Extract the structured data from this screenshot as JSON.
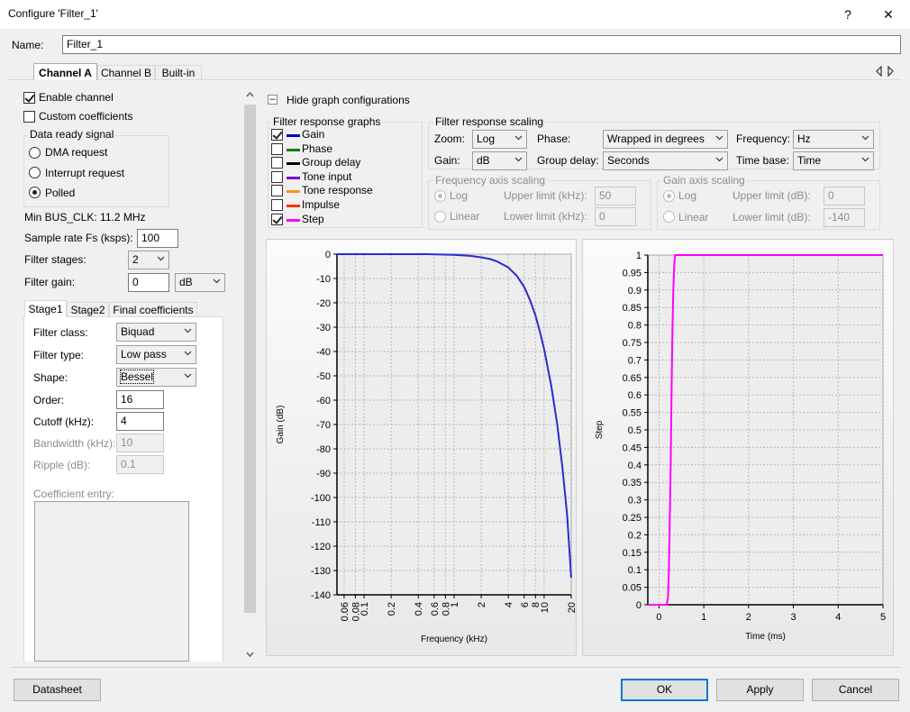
{
  "window": {
    "title": "Configure 'Filter_1'",
    "help_glyph": "?",
    "close_glyph": "✕"
  },
  "name_field": {
    "label": "Name:",
    "value": "Filter_1"
  },
  "tabs": {
    "channel_a": "Channel A",
    "channel_b": "Channel B",
    "builtin": "Built-in"
  },
  "left": {
    "enable_channel": "Enable channel",
    "custom_coefficients": "Custom coefficients",
    "data_ready": {
      "title": "Data ready signal",
      "dma": "DMA request",
      "interrupt": "Interrupt request",
      "polled": "Polled"
    },
    "min_bus_clk": "Min BUS_CLK: 11.2 MHz",
    "sample_rate": {
      "label": "Sample rate Fs (ksps):",
      "value": "100"
    },
    "filter_stages": {
      "label": "Filter stages:",
      "value": "2"
    },
    "filter_gain": {
      "label": "Filter gain:",
      "value": "0",
      "unit": "dB"
    },
    "stage_tabs": {
      "stage1": "Stage1",
      "stage2": "Stage2",
      "final": "Final coefficients"
    },
    "filter_class": {
      "label": "Filter class:",
      "value": "Biquad"
    },
    "filter_type": {
      "label": "Filter type:",
      "value": "Low pass"
    },
    "shape": {
      "label": "Shape:",
      "value": "Bessel"
    },
    "order": {
      "label": "Order:",
      "value": "16"
    },
    "cutoff": {
      "label": "Cutoff (kHz):",
      "value": "4"
    },
    "bandwidth": {
      "label": "Bandwidth (kHz):",
      "value": "10"
    },
    "ripple": {
      "label": "Ripple (dB):",
      "value": "0.1"
    },
    "coefficient_entry": "Coefficient entry:"
  },
  "right": {
    "hide_graph": {
      "glyph": "–",
      "label": "Hide graph configurations"
    },
    "response_graphs": {
      "title": "Filter response graphs",
      "items": [
        {
          "label": "Gain",
          "color": "#0000c0",
          "checked": true
        },
        {
          "label": "Phase",
          "color": "#008000",
          "checked": false
        },
        {
          "label": "Group delay",
          "color": "#000000",
          "checked": false
        },
        {
          "label": "Tone input",
          "color": "#8000c0",
          "checked": false
        },
        {
          "label": "Tone response",
          "color": "#ff9020",
          "checked": false
        },
        {
          "label": "Impulse",
          "color": "#ff3000",
          "checked": false
        },
        {
          "label": "Step",
          "color": "#ff00ff",
          "checked": true
        }
      ]
    },
    "scaling": {
      "title": "Filter response scaling",
      "zoom": {
        "label": "Zoom:",
        "value": "Log"
      },
      "phase": {
        "label": "Phase:",
        "value": "Wrapped in degrees"
      },
      "frequency": {
        "label": "Frequency:",
        "value": "Hz"
      },
      "gain": {
        "label": "Gain:",
        "value": "dB"
      },
      "group_delay": {
        "label": "Group delay:",
        "value": "Seconds"
      },
      "time_base": {
        "label": "Time base:",
        "value": "Time"
      }
    },
    "freq_axis": {
      "title": "Frequency axis scaling",
      "log": "Log",
      "linear": "Linear",
      "upper_label": "Upper limit (kHz):",
      "upper_value": "50",
      "lower_label": "Lower limit (kHz):",
      "lower_value": "0"
    },
    "gain_axis": {
      "title": "Gain axis scaling",
      "log": "Log",
      "linear": "Linear",
      "upper_label": "Upper limit (dB):",
      "upper_value": "0",
      "lower_label": "Lower limit (dB):",
      "lower_value": "-140"
    }
  },
  "buttons": {
    "datasheet": "Datasheet",
    "ok": "OK",
    "apply": "Apply",
    "cancel": "Cancel"
  },
  "chart_data": [
    {
      "type": "line",
      "xlabel": "Frequency (kHz)",
      "ylabel": "Gain (dB)",
      "x_scale": "log",
      "xlim": [
        0.05,
        20
      ],
      "ylim": [
        -140,
        0
      ],
      "x_ticks": [
        "0.06",
        "0.08",
        "0.1",
        "0.2",
        "0.4",
        "0.6",
        "0.8",
        "1",
        "2",
        "4",
        "6",
        "8",
        "10",
        "20"
      ],
      "y_ticks": [
        "0",
        "-10",
        "-20",
        "-30",
        "-40",
        "-50",
        "-60",
        "-70",
        "-80",
        "-90",
        "-100",
        "-110",
        "-120",
        "-130",
        "-140"
      ],
      "grid": true,
      "series": [
        {
          "color": "#2b2bd0",
          "x": [
            0.05,
            0.5,
            1,
            1.5,
            2,
            2.5,
            3,
            4,
            5,
            6,
            7,
            8,
            9,
            10,
            12,
            14,
            16,
            18,
            20
          ],
          "y": [
            0,
            0,
            -0.3,
            -0.7,
            -1.3,
            -2,
            -3,
            -5.5,
            -9,
            -13.5,
            -19,
            -25,
            -32,
            -39,
            -54,
            -70,
            -88,
            -107,
            -133
          ]
        }
      ]
    },
    {
      "type": "line",
      "xlabel": "Time (ms)",
      "ylabel": "Step",
      "xlim": [
        -0.25,
        5
      ],
      "ylim": [
        0,
        1
      ],
      "x_ticks": [
        "0",
        "1",
        "2",
        "3",
        "4",
        "5"
      ],
      "y_ticks": [
        "0",
        "0.05",
        "0.1",
        "0.15",
        "0.2",
        "0.25",
        "0.3",
        "0.35",
        "0.4",
        "0.45",
        "0.5",
        "0.55",
        "0.6",
        "0.65",
        "0.7",
        "0.75",
        "0.8",
        "0.85",
        "0.9",
        "0.95",
        "1"
      ],
      "grid": true,
      "series": [
        {
          "color": "#ff00ff",
          "x": [
            -0.25,
            0.17,
            0.2,
            0.22,
            0.24,
            0.26,
            0.28,
            0.3,
            0.32,
            0.34,
            0.36,
            0.4,
            5
          ],
          "y": [
            0,
            0,
            0.02,
            0.1,
            0.25,
            0.4,
            0.6,
            0.78,
            0.9,
            0.97,
            1.0,
            1.0,
            1.0
          ]
        }
      ]
    }
  ]
}
